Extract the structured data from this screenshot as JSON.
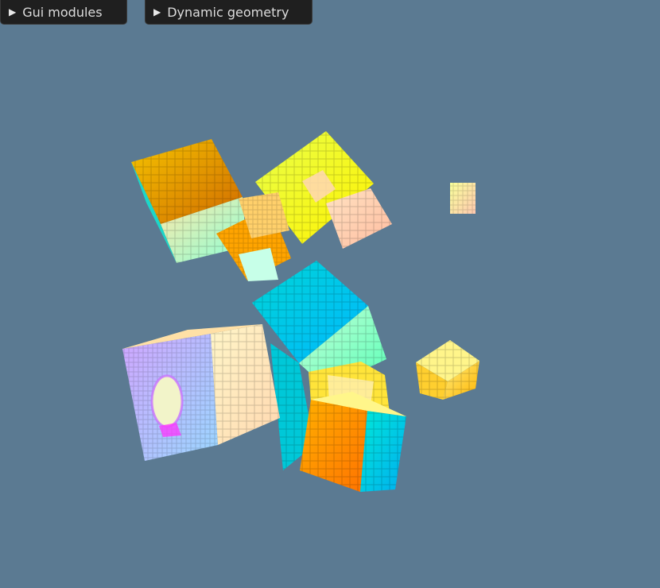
{
  "panels": [
    {
      "label": "Gui modules",
      "arrow": "▶",
      "expanded": false
    },
    {
      "label": "Dynamic geometry",
      "arrow": "▶",
      "expanded": false
    }
  ],
  "scene": {
    "background": "#5b7a92",
    "objects": [
      {
        "name": "voxel-cube-1",
        "colors": [
          "#f5c400",
          "#ff9d00",
          "#b8ffd8"
        ]
      },
      {
        "name": "voxel-cube-2",
        "colors": [
          "#f7f54a",
          "#e9e900",
          "#ffe4b8"
        ]
      },
      {
        "name": "voxel-cube-3",
        "colors": [
          "#ffe06e",
          "#ff9a00",
          "#bdfff0"
        ]
      },
      {
        "name": "voxel-cube-4",
        "colors": [
          "#ffd6c0",
          "#ffcaa8",
          "#f4a9a0"
        ]
      },
      {
        "name": "voxel-cube-5",
        "colors": [
          "#f4ff9a",
          "#ffcaa0",
          "#ffd7b8"
        ]
      },
      {
        "name": "voxel-cube-6",
        "colors": [
          "#00d8d8",
          "#b6ffd0",
          "#00b8e0"
        ]
      },
      {
        "name": "voxel-cube-7",
        "colors": [
          "#d9a6ff",
          "#ffe0b0",
          "#ffc600"
        ]
      },
      {
        "name": "voxel-cube-8",
        "colors": [
          "#ffe000",
          "#ffb000",
          "#fff2a0"
        ]
      },
      {
        "name": "voxel-cube-9",
        "colors": [
          "#ff9f00",
          "#00d8d8",
          "#e8d000"
        ]
      },
      {
        "name": "voxel-cube-10",
        "colors": [
          "#ffd24a",
          "#fff27a",
          "#ffe000"
        ]
      }
    ]
  }
}
